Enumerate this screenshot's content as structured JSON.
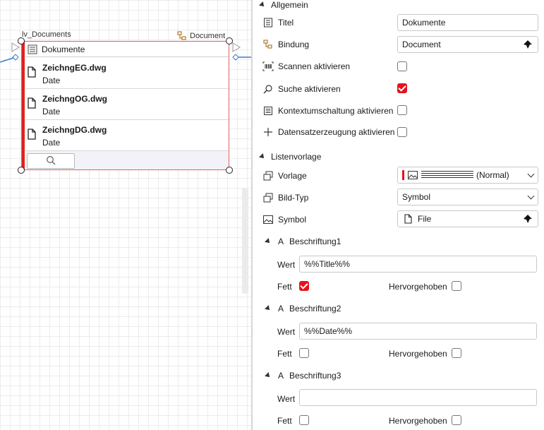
{
  "canvas": {
    "listview_name": "lv_Documents",
    "binding_label": "Document",
    "listview": {
      "header": "Dokumente",
      "items": [
        {
          "title": "ZeichngEG.dwg",
          "subtitle": "Date"
        },
        {
          "title": "ZeichngOG.dwg",
          "subtitle": "Date"
        },
        {
          "title": "ZeichngDG.dwg",
          "subtitle": "Date"
        }
      ]
    }
  },
  "props": {
    "general": {
      "label": "Allgemein",
      "title": {
        "label": "Titel",
        "value": "Dokumente"
      },
      "binding": {
        "label": "Bindung",
        "value": "Document"
      },
      "scan": {
        "label": "Scannen aktivieren",
        "checked": false
      },
      "search": {
        "label": "Suche aktivieren",
        "checked": true
      },
      "context": {
        "label": "Kontextumschaltung aktivieren",
        "checked": false
      },
      "create": {
        "label": "Datensatzerzeugung aktivieren",
        "checked": false
      }
    },
    "template": {
      "label": "Listenvorlage",
      "vorlage": {
        "label": "Vorlage",
        "value": "(Normal)"
      },
      "image_type": {
        "label": "Bild-Typ",
        "value": "Symbol"
      },
      "symbol": {
        "label": "Symbol",
        "value": "File"
      }
    },
    "captions": [
      {
        "header": "Beschriftung1",
        "value_label": "Wert",
        "value": "%%Title%%",
        "bold_label": "Fett",
        "bold": true,
        "highlight_label": "Hervorgehoben",
        "highlight": false
      },
      {
        "header": "Beschriftung2",
        "value_label": "Wert",
        "value": "%%Date%%",
        "bold_label": "Fett",
        "bold": false,
        "highlight_label": "Hervorgehoben",
        "highlight": false
      },
      {
        "header": "Beschriftung3",
        "value_label": "Wert",
        "value": "",
        "bold_label": "Fett",
        "bold": false,
        "highlight_label": "Hervorgehoben",
        "highlight": false
      }
    ],
    "caption_icon_glyph": "A"
  },
  "colors": {
    "accent_red": "#e8121b",
    "selection_border": "#e06060"
  },
  "icons": [
    "list-icon",
    "binding-icon",
    "barcode-icon",
    "search-icon",
    "plus-icon",
    "template-icon",
    "image-icon",
    "file-icon",
    "pin-icon",
    "chevron-down-icon"
  ]
}
